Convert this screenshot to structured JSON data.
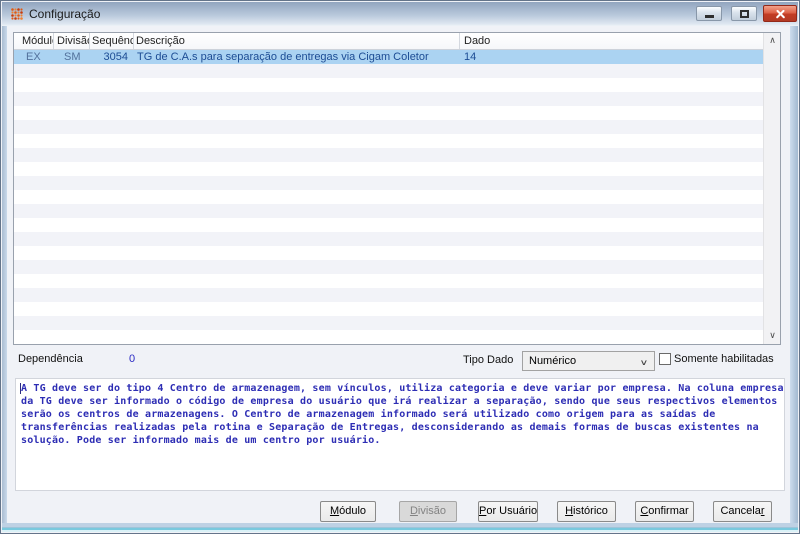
{
  "window": {
    "title": "Configuração"
  },
  "titlebar_icons": {
    "app": "cigam-dots-grid",
    "minimize": "minimize-bar",
    "maximize": "maximize-square",
    "close": "close-x"
  },
  "table": {
    "columns": [
      {
        "label": "Módulo"
      },
      {
        "label": "Divisão"
      },
      {
        "label": "Sequência"
      },
      {
        "label": "Descrição"
      },
      {
        "label": "Dado"
      }
    ],
    "selected_row": {
      "modulo": "EX",
      "divisao": "SM",
      "sequencia": "3054",
      "descricao": "TG de C.A.s para separação de entregas via Cigam Coletor",
      "dado": "14"
    },
    "scrollbar": {
      "up_glyph": "∧",
      "down_glyph": "∨"
    }
  },
  "fields": {
    "dependencia": {
      "label": "Dependência",
      "value": "0"
    },
    "tipo_dado": {
      "label": "Tipo Dado",
      "value": "Numérico",
      "chevron_glyph": "∨"
    },
    "somente_habilitadas": {
      "label": "Somente habilitadas",
      "checked": false
    }
  },
  "description": {
    "lines": [
      "A TG deve ser do tipo 4 Centro de armazenagem, sem vínculos, utiliza categoria e deve variar por empresa. Na coluna empresa",
      "da TG deve ser informado o código de empresa do usuário que irá realizar a separação, sendo que seus respectivos elementos",
      "serão os centros de armazenagens. O Centro de armazenagem informado será utilizado como origem para as saídas de",
      "transferências realizadas pela rotina e Separação de Entregas, desconsiderando as demais formas de buscas existentes na",
      "solução. Pode ser informado mais de um centro por usuário."
    ]
  },
  "footer": {
    "buttons": [
      {
        "name": "modulo-button",
        "pre": "",
        "key": "M",
        "post": "ódulo",
        "disabled": false
      },
      {
        "name": "divisao-button",
        "pre": "",
        "key": "D",
        "post": "ivisão",
        "disabled": true
      },
      {
        "name": "por-usuario-button",
        "pre": "",
        "key": "P",
        "post": "or Usuário",
        "disabled": false
      },
      {
        "name": "historico-button",
        "pre": "",
        "key": "H",
        "post": "istórico",
        "disabled": false
      },
      {
        "name": "confirmar-button",
        "pre": "",
        "key": "C",
        "post": "onfirmar",
        "disabled": false
      },
      {
        "name": "cancelar-button",
        "pre": "Cancela",
        "key": "r",
        "post": "",
        "disabled": false
      }
    ]
  },
  "colors": {
    "selection_bg": "#abd3f2",
    "selection_text": "#1c4c94",
    "selection_text_muted": "#53719c",
    "info_text": "#2d2db4",
    "close_button": "#c23c24",
    "titlebar_top": "#92a5bf",
    "titlebar_bottom": "#eef3f8",
    "window_border": "#a9bcd1"
  }
}
